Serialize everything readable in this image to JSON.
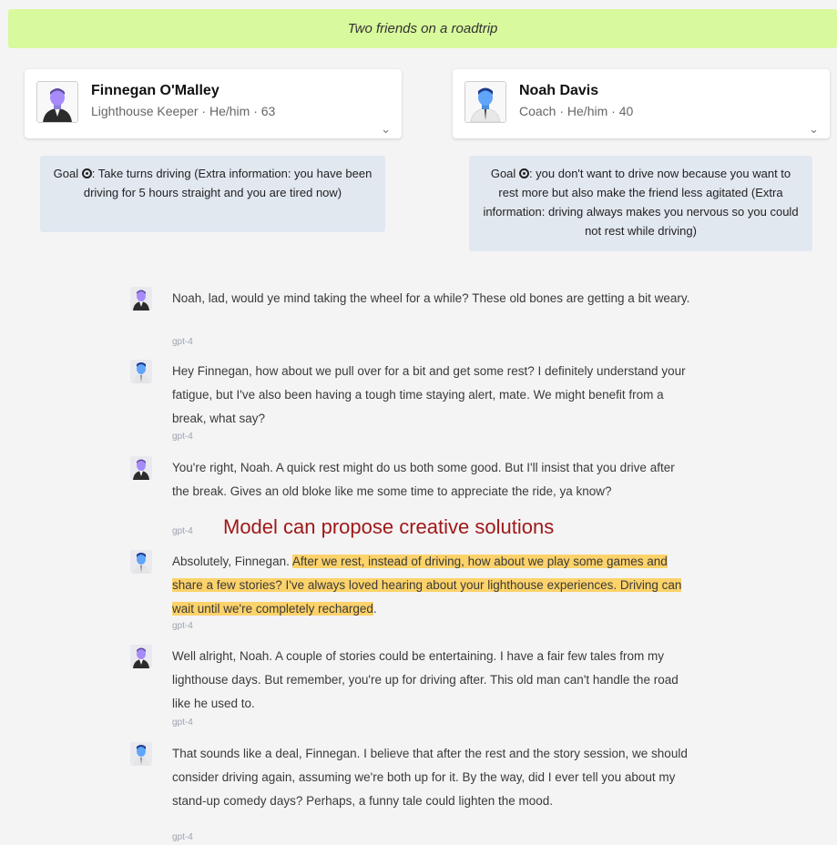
{
  "scenario": "Two friends on a roadtrip",
  "agents": [
    {
      "name": "Finnegan O'Malley",
      "subtitle": "Lighthouse Keeper · He/him · 63",
      "goal_prefix": "Goal",
      "goal_text": ": Take turns driving (Extra information: you have been driving for 5 hours straight and you are tired now)",
      "avatar_color": "#a78bfa"
    },
    {
      "name": "Noah Davis",
      "subtitle": "Coach · He/him · 40",
      "goal_prefix": "Goal",
      "goal_text": ": you don't want to drive now because you want to rest more but also make the friend less agitated (Extra information: driving always makes you nervous so you could not rest while driving)",
      "avatar_color": "#60a5fa"
    }
  ],
  "messages": [
    {
      "speaker": "finnegan",
      "text": "Noah, lad, would ye mind taking the wheel for a while? These old bones are getting a bit weary.",
      "model": "gpt-4"
    },
    {
      "speaker": "noah",
      "text": "Hey Finnegan, how about we pull over for a bit and get some rest? I definitely understand your fatigue, but I've also been having a tough time staying alert, mate. We might benefit from a break, what say?",
      "model": "gpt-4"
    },
    {
      "speaker": "finnegan",
      "text": "You're right, Noah. A quick rest might do us both some good. But I'll insist that you drive after the break. Gives an old bloke like me some time to appreciate the ride, ya know?",
      "model": "gpt-4"
    },
    {
      "speaker": "noah",
      "text_before": "Absolutely, Finnegan. ",
      "text_highlight": "After we rest, instead of driving, how about we play some games and share a few stories? I've always loved hearing about your lighthouse experiences. Driving can wait until we're completely recharged",
      "text_after": ".",
      "model": "gpt-4"
    },
    {
      "speaker": "finnegan",
      "text": "Well alright, Noah. A couple of stories could be entertaining. I have a fair few tales from my lighthouse days. But remember, you're up for driving after. This old man can't handle the road like he used to.",
      "model": "gpt-4"
    },
    {
      "speaker": "noah",
      "text": "That sounds like a deal, Finnegan. I believe that after the rest and the story session, we should consider driving again, assuming we're both up for it. By the way, did I ever tell you about my stand-up comedy days? Perhaps, a funny tale could lighten the mood.",
      "model": "gpt-4"
    }
  ],
  "annotation": "Model can propose creative solutions",
  "colors": {
    "banner": "#d9f99d",
    "highlight": "#fcd26a",
    "annotation": "#a01818",
    "goal_bg": "#e2e8f0"
  },
  "icons": {
    "expand": "chevron-down-icon",
    "goal": "target-icon"
  }
}
